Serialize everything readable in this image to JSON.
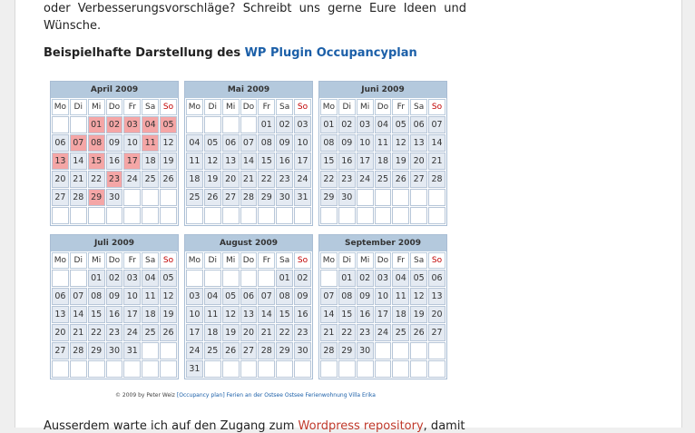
{
  "intro": {
    "line1": "oder Verbesserungsvorschläge? Schreibt uns gerne Eure Ideen und",
    "line2": "Wünsche."
  },
  "heading": {
    "text": "Beispielhafte Darstellung des ",
    "link": "WP Plugin Occupancyplan"
  },
  "weekdays": [
    "Mo",
    "Di",
    "Mi",
    "Do",
    "Fr",
    "Sa",
    "So"
  ],
  "calendars": [
    {
      "title": "April 2009",
      "offset": 2,
      "days": 30,
      "occupied": [
        1,
        2,
        3,
        4,
        5,
        7,
        8,
        11,
        13,
        15,
        17,
        23,
        29
      ]
    },
    {
      "title": "Mai 2009",
      "offset": 4,
      "days": 31,
      "occupied": []
    },
    {
      "title": "Juni 2009",
      "offset": 0,
      "days": 30,
      "occupied": []
    },
    {
      "title": "Juli 2009",
      "offset": 2,
      "days": 31,
      "occupied": []
    },
    {
      "title": "August 2009",
      "offset": 5,
      "days": 31,
      "occupied": []
    },
    {
      "title": "September 2009",
      "offset": 1,
      "days": 30,
      "occupied": []
    }
  ],
  "credit": {
    "text": "© 2009 by Peter Weiz",
    "link1": "[Occupancy plan]",
    "link2": "Ferien an der Ostsee",
    "link3": "Ostsee Ferienwohnung Villa Erika"
  },
  "outro": {
    "text": "Ausserdem warte ich auf den Zugang zum ",
    "link": "Wordpress repository",
    "after": ", damit"
  },
  "colors": {
    "occupied": "#f4a6a6",
    "free": "#e4eaf2",
    "header": "#b4c9dd",
    "sunday": "#c00000",
    "link": "#1b5fa8"
  }
}
